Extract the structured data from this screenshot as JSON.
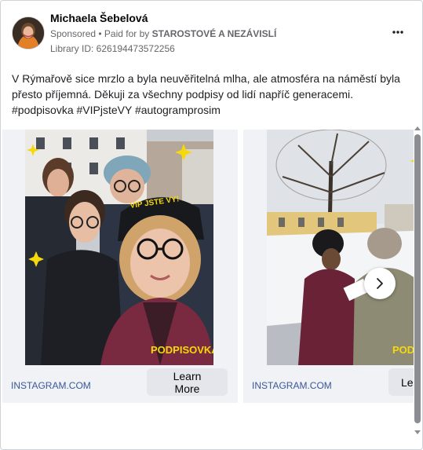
{
  "ad": {
    "page_name": "Michaela Šebelová",
    "sponsored": "Sponsored",
    "separator": " • ",
    "paid_for_prefix": "Paid for by ",
    "paid_for_name": "STAROSTOVÉ A NEZÁVISLÍ",
    "library_id": "Library ID: 626194473572256",
    "body_lines": [
      "V Rýmařově sice mrzlo a byla neuvěřitelná mlha, ale atmosféra na náměstí byla",
      "přesto příjemná. Děkuji za všechny podpisy od lidí napříč generacemi.",
      "#podpisovka #VIPjsteVY #autogramprosim"
    ]
  },
  "cards": [
    {
      "domain": "INSTAGRAM.COM",
      "cta": "Learn More",
      "beanie_text": "VIP JSTE VY!",
      "sticker_text": "PODPISOVKA"
    },
    {
      "domain": "INSTAGRAM.COM",
      "cta": "Le",
      "sticker_text": "PODPIS"
    }
  ],
  "icons": {
    "more": "more-horizontal-icon",
    "next": "chevron-right-icon",
    "scroll_up": "scroll-up-arrow-icon",
    "scroll_down": "scroll-down-arrow-icon"
  },
  "colors": {
    "link": "#385898",
    "button_bg": "#e4e6eb",
    "card_bg": "#f0f2f5",
    "sticker_yellow": "#f5d90a"
  }
}
